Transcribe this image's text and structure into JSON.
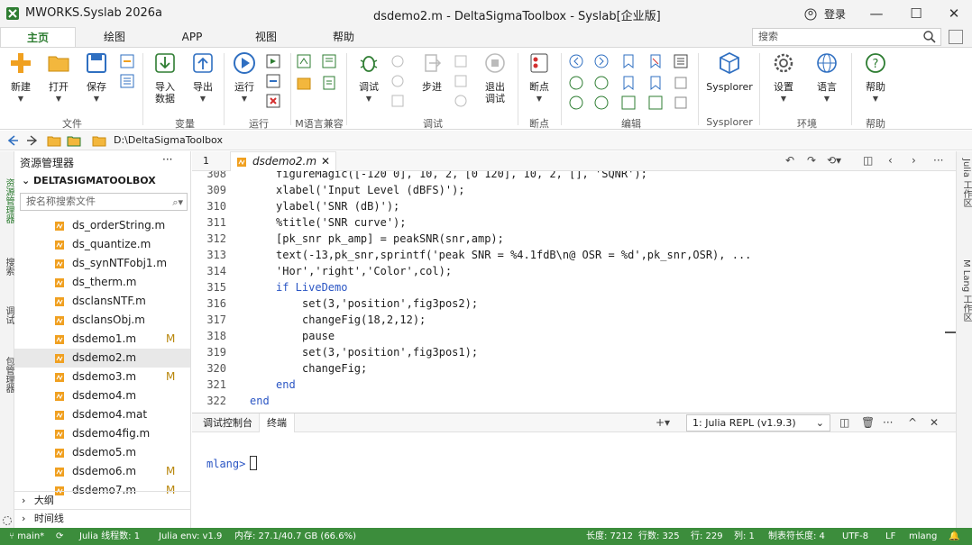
{
  "titlebar": {
    "app_title": "MWORKS.Syslab 2026a",
    "doc_title": "dsdemo2.m - DeltaSigmaToolbox - Syslab[企业版]",
    "login": "登录",
    "min": "—",
    "max": "☐",
    "close": "✕"
  },
  "ribbon_tabs": [
    "主页",
    "绘图",
    "APP",
    "视图",
    "帮助"
  ],
  "search": {
    "placeholder": "搜索"
  },
  "ribbon": {
    "new": "新建",
    "open": "打开",
    "save": "保存",
    "import_1": "导入",
    "import_2": "数据",
    "export": "导出",
    "run": "运行",
    "debug": "调试",
    "step": "步进",
    "exit_1": "退出",
    "exit_2": "调试",
    "breakpoint": "断点",
    "sysplorer": "Sysplorer",
    "settings": "设置",
    "language": "语言",
    "help": "帮助",
    "groups": {
      "file": "文件",
      "variable": "变量",
      "run": "运行",
      "mlang": "M语言兼容",
      "debug": "调试",
      "breakpoint": "断点",
      "edit": "编辑",
      "sysplorer": "Sysplorer",
      "env": "环境",
      "help": "帮助"
    }
  },
  "path": {
    "current": "D:\\DeltaSigmaToolbox"
  },
  "activity": {
    "explorer": "资源管理器",
    "search": "搜索",
    "debug": "调试",
    "packages": "包管理器"
  },
  "explorer": {
    "title": "资源管理器",
    "more": "···",
    "project": "DELTASIGMATOOLBOX",
    "filter_placeholder": "按名称搜索文件",
    "files": [
      {
        "name": "ds_orderString.m",
        "badge": ""
      },
      {
        "name": "ds_quantize.m",
        "badge": ""
      },
      {
        "name": "ds_synNTFobj1.m",
        "badge": ""
      },
      {
        "name": "ds_therm.m",
        "badge": ""
      },
      {
        "name": "dsclansNTF.m",
        "badge": ""
      },
      {
        "name": "dsclansObj.m",
        "badge": ""
      },
      {
        "name": "dsdemo1.m",
        "badge": "M"
      },
      {
        "name": "dsdemo2.m",
        "badge": ""
      },
      {
        "name": "dsdemo3.m",
        "badge": "M"
      },
      {
        "name": "dsdemo4.m",
        "badge": ""
      },
      {
        "name": "dsdemo4.mat",
        "badge": ""
      },
      {
        "name": "dsdemo4fig.m",
        "badge": ""
      },
      {
        "name": "dsdemo5.m",
        "badge": ""
      },
      {
        "name": "dsdemo6.m",
        "badge": "M"
      },
      {
        "name": "dsdemo7.m",
        "badge": "M"
      }
    ],
    "outline": "大纲",
    "timeline": "时间线"
  },
  "editor": {
    "tab_label": "dsdemo2.m",
    "tab_marker": "1",
    "lines": [
      {
        "n": "308",
        "t": "figureMagic([-120 0], 10, 2, [0 120], 10, 2, [], 'SQNR');",
        "kw": false,
        "indent": 2
      },
      {
        "n": "309",
        "t": "xlabel('Input Level (dBFS)');",
        "kw": false,
        "indent": 2
      },
      {
        "n": "310",
        "t": "ylabel('SNR (dB)');",
        "kw": false,
        "indent": 2
      },
      {
        "n": "311",
        "t": "%title('SNR curve');",
        "kw": false,
        "indent": 2
      },
      {
        "n": "312",
        "t": "[pk_snr pk_amp] = peakSNR(snr,amp);",
        "kw": false,
        "indent": 2
      },
      {
        "n": "313",
        "t": "text(-13,pk_snr,sprintf('peak SNR = %4.1fdB\\n@ OSR = %d',pk_snr,OSR), ...",
        "kw": false,
        "indent": 2
      },
      {
        "n": "314",
        "t": "'Hor','right','Color',col);",
        "kw": false,
        "indent": 2
      },
      {
        "n": "315",
        "t": "if LiveDemo",
        "kw": true,
        "indent": 2
      },
      {
        "n": "316",
        "t": "set(3,'position',fig3pos2);",
        "kw": false,
        "indent": 4
      },
      {
        "n": "317",
        "t": "changeFig(18,2,12);",
        "kw": false,
        "indent": 4
      },
      {
        "n": "318",
        "t": "pause",
        "kw": false,
        "indent": 4
      },
      {
        "n": "319",
        "t": "set(3,'position',fig3pos1);",
        "kw": false,
        "indent": 4
      },
      {
        "n": "320",
        "t": "changeFig;",
        "kw": false,
        "indent": 4
      },
      {
        "n": "321",
        "t": "end",
        "kw": true,
        "indent": 2
      },
      {
        "n": "322",
        "t": "end",
        "kw": true,
        "indent": 0
      }
    ]
  },
  "panel": {
    "tab_debug_console": "调试控制台",
    "tab_terminal": "终端",
    "repl_select": "1: Julia REPL (v1.9.3)",
    "prompt": "mlang>"
  },
  "right_gutter": {
    "julia": "Julia 工作区",
    "mlang": "M Lang 工作区"
  },
  "status": {
    "branch": "main*",
    "threads": "Julia 线程数: 1",
    "env": "Julia env: v1.9",
    "memory": "内存: 27.1/40.7 GB (66.6%)",
    "length": "长度: 7212",
    "lines": "行数: 325",
    "position": "行: 229",
    "column": "列: 1",
    "tab_size": "制表符长度: 4",
    "encoding": "UTF-8",
    "eol": "LF",
    "language": "mlang"
  },
  "colors": {
    "brand_green": "#2e7d32",
    "status_green": "#3c8d3c",
    "keyword_blue": "#2b56c4",
    "modified_badge": "#b8860b"
  }
}
